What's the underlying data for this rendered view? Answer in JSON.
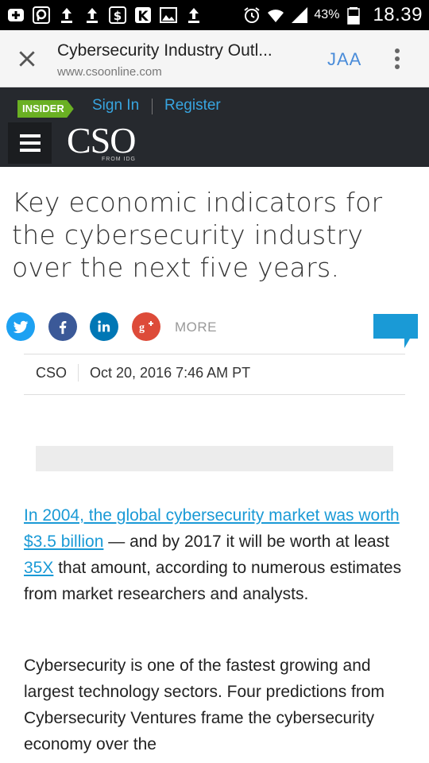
{
  "status_bar": {
    "battery_percent": "43%",
    "time": "18.39",
    "icons": [
      "add-box-icon",
      "p-badge-icon",
      "upload-icon",
      "upload-icon",
      "dollar-badge-icon",
      "k-badge-icon",
      "image-icon",
      "upload-icon",
      "alarm-icon",
      "wifi-icon",
      "signal-icon",
      "battery-icon"
    ]
  },
  "browser": {
    "page_title": "Cybersecurity Industry Outl...",
    "url": "www.csoonline.com",
    "jaa_label": "JAA"
  },
  "site_header": {
    "badge": "INSIDER",
    "sign_in": "Sign In",
    "register": "Register",
    "logo": "CSO",
    "logo_sub": "FROM IDG",
    "colors": {
      "bg": "#26292e",
      "link": "#38a5e0",
      "badge": "#6ab023"
    }
  },
  "article": {
    "headline": "Key economic indicators for the cybersecurity industry over the next five years.",
    "share": {
      "twitter_icon": "twitter-icon",
      "facebook_icon": "facebook-icon",
      "linkedin_icon": "linkedin-icon",
      "gplus_icon": "google-plus-icon",
      "more_label": "MORE",
      "comment_icon": "comment-bubble-icon"
    },
    "byline": {
      "author": "CSO",
      "date": "Oct 20, 2016 7:46 AM PT"
    },
    "para1": {
      "link1": "In 2004, the global cybersecurity market was worth $3.5 billion",
      "text1": " — and by 2017 it will be worth at least ",
      "link2": "35X",
      "text2": " that amount, according to numerous estimates from market researchers and analysts."
    },
    "para2": "Cybersecurity is one of the fastest growing and largest technology sectors. Four predictions from Cybersecurity Ventures frame the cybersecurity economy over the"
  }
}
